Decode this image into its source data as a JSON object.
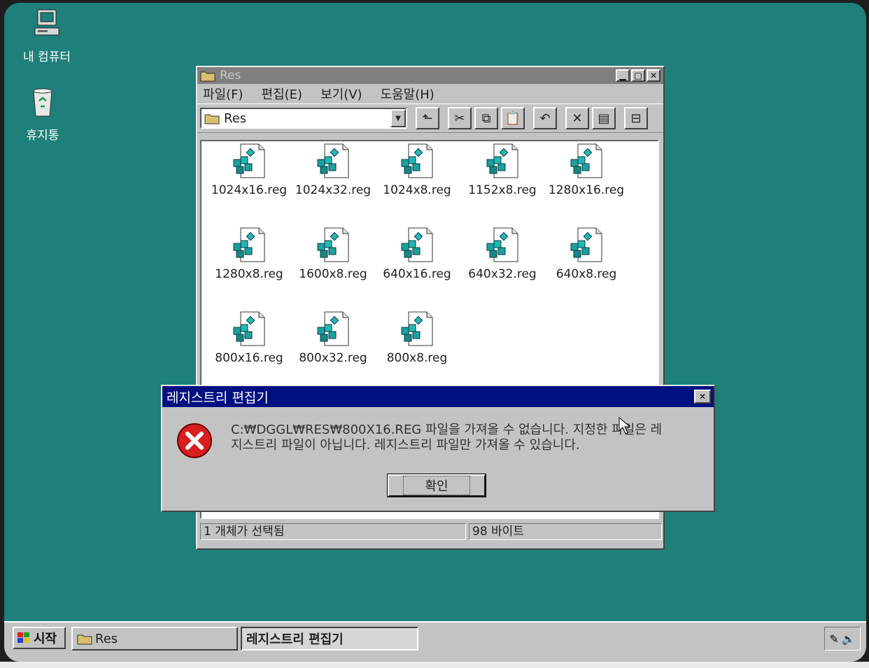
{
  "desktop": {
    "icons": [
      {
        "label": "내 컴퓨터",
        "icon": "my-computer-icon"
      },
      {
        "label": "휴지통",
        "icon": "recycle-bin-icon"
      }
    ]
  },
  "explorer": {
    "title": "Res",
    "menu": [
      "파일(F)",
      "편집(E)",
      "보기(V)",
      "도움말(H)"
    ],
    "address": "Res",
    "toolbar_icons": [
      "up-folder-icon",
      "cut-icon",
      "copy-icon",
      "paste-icon",
      "undo-icon",
      "delete-icon",
      "properties-icon",
      "view-icon"
    ],
    "files": [
      "1024x16.reg",
      "1024x32.reg",
      "1024x8.reg",
      "1152x8.reg",
      "1280x16.reg",
      "1280x8.reg",
      "1600x8.reg",
      "640x16.reg",
      "640x32.reg",
      "640x8.reg",
      "800x16.reg",
      "800x32.reg",
      "800x8.reg"
    ],
    "status_left": "1 개체가 선택됨",
    "status_right": "98 바이트"
  },
  "dialog": {
    "title": "레지스트리 편집기",
    "line1": "C:₩DGGL₩RES₩800X16.REG 파일을 가져올 수 없습니다. 지정한 파일은 레",
    "line2": "지스트리 파일이 아닙니다. 레지스트리 파일만 가져올 수 있습니다.",
    "ok_label": "확인",
    "icon": "error-icon"
  },
  "taskbar": {
    "start_label": "시작",
    "tasks": [
      "Res",
      "레지스트리 편집기"
    ],
    "tray_icons": [
      "pen-icon",
      "speaker-icon"
    ]
  },
  "colors": {
    "desktop": "#1f7f7a",
    "active_title": "#001080",
    "inactive_title": "#7f7f7f",
    "error_red": "#d81e1e"
  }
}
